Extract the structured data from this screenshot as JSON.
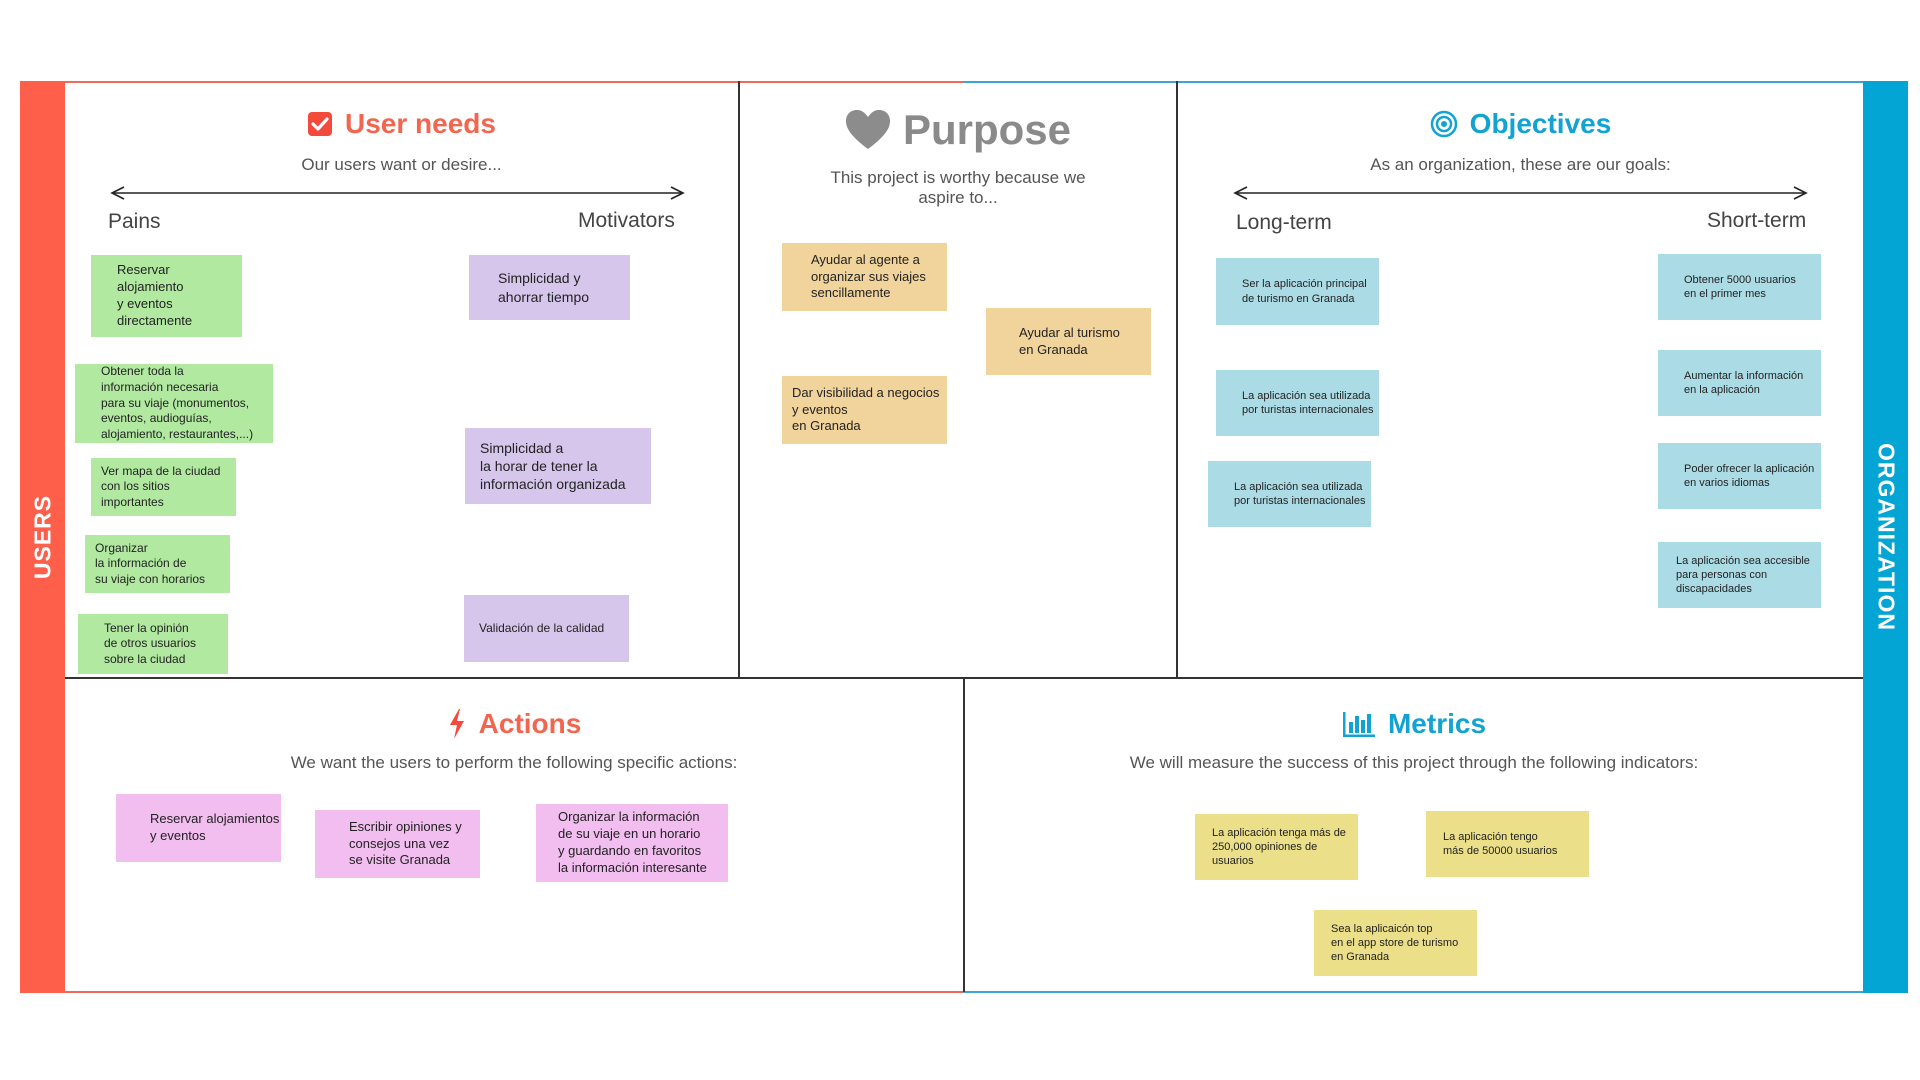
{
  "side_labels": {
    "left": "USERS",
    "right": "ORGANIZATION"
  },
  "colors": {
    "users_accent": "#fe5f4b",
    "organization_accent": "#03a5d5",
    "purpose_gray": "#8a8a8a"
  },
  "user_needs": {
    "title": "User needs",
    "subtitle": "Our users want or desire...",
    "axis_left": "Pains",
    "axis_right": "Motivators",
    "icon": "checkbox-icon",
    "pains": [
      "Reservar\nalojamiento\ny eventos\ndirectamente",
      "Obtener toda la\ninformación necesaria\npara su viaje (monumentos,\neventos, audioguías,\nalojamiento, restaurantes,...)",
      "Ver mapa de la ciudad\ncon los sitios\nimportantes",
      "Organizar\nla información de\nsu viaje con horarios",
      "Tener la opinión\nde otros usuarios\nsobre la ciudad"
    ],
    "motivators": [
      "Simplicidad y\nahorrar tiempo",
      "Simplicidad a\nla horar de tener la\ninformación organizada",
      "Validación de la calidad"
    ]
  },
  "purpose": {
    "title": "Purpose",
    "subtitle": "This project is worthy because we\naspire to...",
    "icon": "heart-icon",
    "notes": [
      "Ayudar al agente a\norganizar sus viajes\nsencillamente",
      "Ayudar al turismo\nen Granada",
      "Dar visibilidad a negocios\ny eventos\nen Granada"
    ]
  },
  "objectives": {
    "title": "Objectives",
    "subtitle": "As an organization, these are our goals:",
    "axis_left": "Long-term",
    "axis_right": "Short-term",
    "icon": "target-icon",
    "long_term": [
      "Ser la aplicación principal\nde turismo en Granada",
      "La aplicación sea utilizada\npor turistas internacionales",
      "La aplicación sea utilizada\npor turistas internacionales"
    ],
    "short_term": [
      "Obtener 5000  usuarios\nen el primer mes",
      "Aumentar la información\nen la aplicación",
      "Poder ofrecer la aplicación\nen varios idiomas",
      "La aplicación sea accesible\npara personas con\ndiscapacidades"
    ]
  },
  "actions": {
    "title": "Actions",
    "subtitle": "We want the users to perform the following specific actions:",
    "icon": "lightning-icon",
    "notes": [
      "Reservar alojamientos\ny eventos",
      "Escribir opiniones y\nconsejos una vez\nse visite Granada",
      "Organizar la información\nde su viaje en un horario\ny guardando en favoritos\nla información interesante"
    ]
  },
  "metrics": {
    "title": "Metrics",
    "subtitle": "We will measure the success of this project through the following indicators:",
    "icon": "bar-chart-icon",
    "notes": [
      "La aplicación tenga más de\n250,000 opiniones de\nusuarios",
      "La aplicación tengo\nmás de 50000 usuarios",
      "Sea la aplicaicón top\nen el app store de turismo\nen Granada"
    ]
  }
}
